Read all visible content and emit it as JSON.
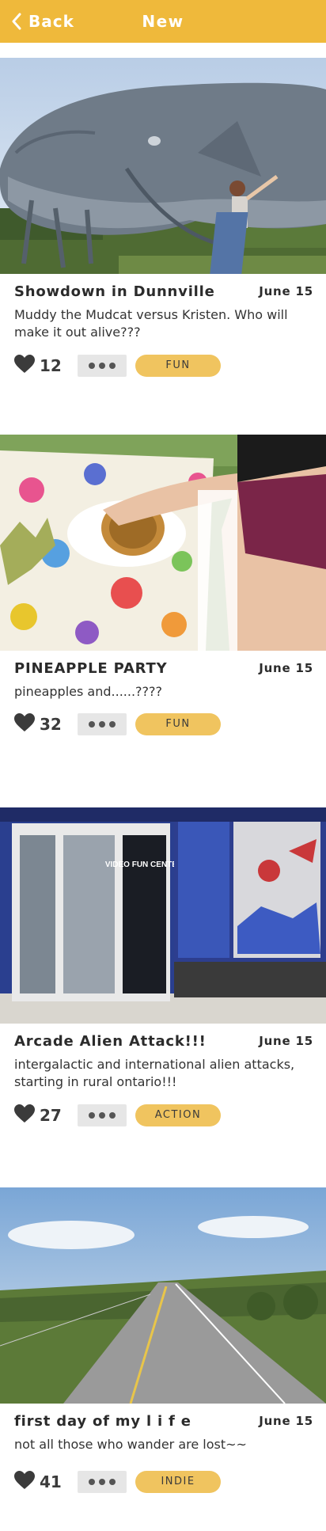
{
  "header": {
    "back_label": "Back",
    "title": "New",
    "color": "#efb93b"
  },
  "posts": [
    {
      "title": "Showdown in Dunnville",
      "date": "June 15",
      "description": "Muddy the Mudcat versus Kristen. Who will make it out alive???",
      "likes": "12",
      "tag": "FUN",
      "image": "giant-catfish-statue-photo"
    },
    {
      "title": "PINEAPPLE PARTY",
      "date": "June 15",
      "description": "pineapples and......????",
      "likes": "32",
      "tag": "FUN",
      "image": "pineapple-table-photo"
    },
    {
      "title": "Arcade Alien Attack!!!",
      "date": "June 15",
      "description": "intergalactic and international alien attacks, starting in rural ontario!!!",
      "likes": "27",
      "tag": "ACTION",
      "image": "video-fun-center-storefront-photo",
      "door_sign": "VIDEO FUN CENTER"
    },
    {
      "title": "first day of my l i f e",
      "date": "June 15",
      "description": "not all those who wander are lost~~",
      "likes": "41",
      "tag": "INDIE",
      "image": "country-road-photo"
    }
  ],
  "icons": {
    "back": "chevron-left-icon",
    "like": "heart-icon",
    "more": "more-dots-icon"
  },
  "colors": {
    "tag_bg": "#f0c45f",
    "more_bg": "#e6e6e6"
  }
}
